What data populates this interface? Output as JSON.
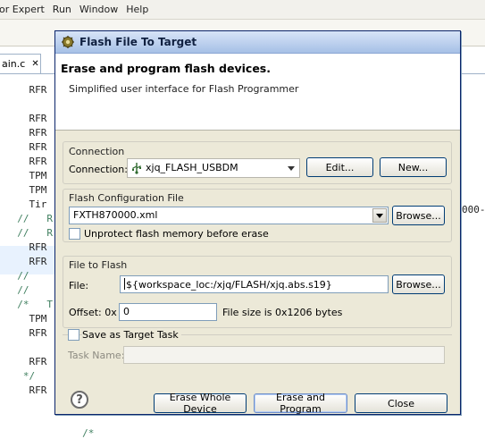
{
  "ide": {
    "menu": [
      "or Expert",
      "Run",
      "Window",
      "Help"
    ],
    "editor_tab": {
      "label": "ain.c",
      "close": "✕"
    },
    "code_lines": [
      "    RFR",
      "",
      "    RFR",
      "    RFR",
      "    RFR",
      "    RFR",
      "    TPM",
      "    TPM",
      "    Tir",
      "  //   R",
      "  //   R",
      "    RFR",
      "    RFR",
      "  //",
      "  //",
      "  /*   T",
      "    TPM",
      "    RFR",
      "",
      "    RFR",
      "   */",
      "    RFR",
      "",
      "",
      "             /*"
    ],
    "code_tail": "000-"
  },
  "dialog": {
    "title": "Flash File To Target",
    "heading": "Erase and program flash devices.",
    "subheading": "Simplified user interface for Flash Programmer",
    "connection": {
      "group_label": "Connection",
      "label": "Connection:",
      "value": "xjq_FLASH_USBDM",
      "edit_button": "Edit...",
      "new_button": "New..."
    },
    "flash_config": {
      "group_label": "Flash Configuration File",
      "value": "FXTH870000.xml",
      "browse_button": "Browse...",
      "unprotect_label": "Unprotect flash memory before erase",
      "unprotect_checked": false
    },
    "file_to_flash": {
      "group_label": "File to Flash",
      "file_label": "File:",
      "file_value": "${workspace_loc:/xjq/FLASH/xjq.abs.s19}",
      "browse_button": "Browse...",
      "offset_label": "Offset: 0x",
      "offset_value": "0",
      "size_text": "File size is 0x1206 bytes"
    },
    "target_task": {
      "save_label": "Save as Target Task",
      "save_checked": false,
      "task_name_label": "Task Name:",
      "task_name_value": ""
    },
    "buttons": {
      "help": "?",
      "erase_whole": "Erase Whole Device",
      "erase_program": "Erase and Program",
      "close": "Close"
    }
  },
  "colors": {
    "dialog_bg": "#ece9d8",
    "title_gradient_top": "#d7e4f7",
    "title_gradient_bottom": "#a6c0e6",
    "comment_green": "#3f7f5f",
    "field_border": "#7f9db9"
  },
  "icons": {
    "app": "gear-bug-icon",
    "connection": "usb-connection-icon",
    "help": "help-icon"
  }
}
